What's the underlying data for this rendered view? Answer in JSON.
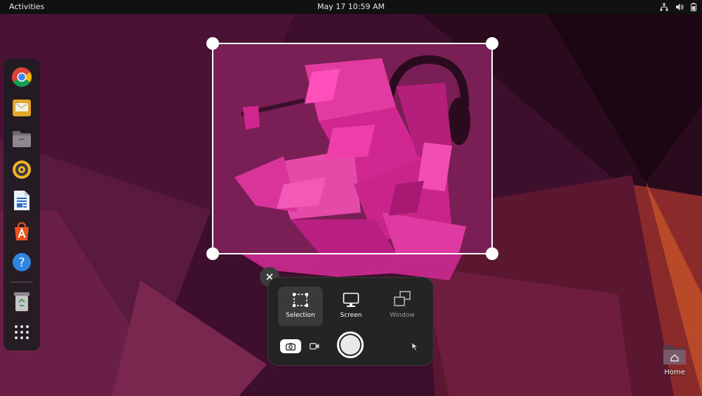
{
  "topbar": {
    "activities": "Activities",
    "datetime": "May 17  10:59 AM",
    "tray_icons": [
      "network-icon",
      "volume-icon",
      "battery-icon"
    ]
  },
  "dock": {
    "items": [
      {
        "name": "chrome-icon"
      },
      {
        "name": "mail-icon"
      },
      {
        "name": "files-icon"
      },
      {
        "name": "rhythmbox-icon"
      },
      {
        "name": "libreoffice-writer-icon"
      },
      {
        "name": "app-center-icon"
      },
      {
        "name": "help-icon"
      },
      {
        "name": "trash-icon"
      },
      {
        "name": "show-apps-icon"
      }
    ]
  },
  "screenshot_ui": {
    "modes": [
      {
        "label": "Selection",
        "icon": "selection-icon",
        "active": true
      },
      {
        "label": "Screen",
        "icon": "screen-icon",
        "active": false
      },
      {
        "label": "Window",
        "icon": "window-icon",
        "active": false
      }
    ],
    "capture_type": "screenshot",
    "show_pointer": false
  },
  "desktop": {
    "home_label": "Home"
  },
  "colors": {
    "accent": "#e4208a",
    "panel_bg": "#242424",
    "topbar_bg": "#111111"
  }
}
